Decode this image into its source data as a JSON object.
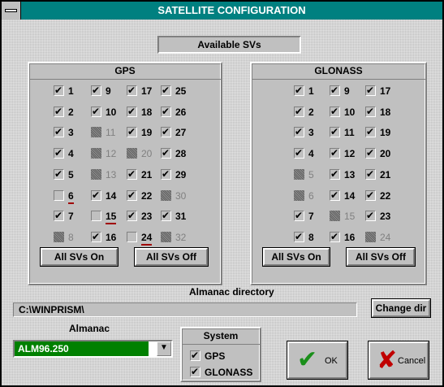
{
  "window": {
    "title": "SATELLITE CONFIGURATION",
    "menu_icon": "system-menu-icon"
  },
  "available_label": "Available SVs",
  "gps": {
    "title": "GPS",
    "svs": [
      {
        "n": "1",
        "state": "on"
      },
      {
        "n": "9",
        "state": "on"
      },
      {
        "n": "17",
        "state": "on"
      },
      {
        "n": "25",
        "state": "on"
      },
      {
        "n": "2",
        "state": "on"
      },
      {
        "n": "10",
        "state": "on"
      },
      {
        "n": "18",
        "state": "on"
      },
      {
        "n": "26",
        "state": "on"
      },
      {
        "n": "3",
        "state": "on"
      },
      {
        "n": "11",
        "state": "grey"
      },
      {
        "n": "19",
        "state": "on"
      },
      {
        "n": "27",
        "state": "on"
      },
      {
        "n": "4",
        "state": "on"
      },
      {
        "n": "12",
        "state": "grey"
      },
      {
        "n": "20",
        "state": "grey"
      },
      {
        "n": "28",
        "state": "on"
      },
      {
        "n": "5",
        "state": "on"
      },
      {
        "n": "13",
        "state": "grey"
      },
      {
        "n": "21",
        "state": "on"
      },
      {
        "n": "29",
        "state": "on"
      },
      {
        "n": "6",
        "state": "off"
      },
      {
        "n": "14",
        "state": "on"
      },
      {
        "n": "22",
        "state": "on"
      },
      {
        "n": "30",
        "state": "grey"
      },
      {
        "n": "7",
        "state": "on"
      },
      {
        "n": "15",
        "state": "off"
      },
      {
        "n": "23",
        "state": "on"
      },
      {
        "n": "31",
        "state": "on"
      },
      {
        "n": "8",
        "state": "grey"
      },
      {
        "n": "16",
        "state": "on"
      },
      {
        "n": "24",
        "state": "off"
      },
      {
        "n": "32",
        "state": "grey"
      }
    ],
    "all_on": "All SVs On",
    "all_off": "All SVs Off"
  },
  "glonass": {
    "title": "GLONASS",
    "svs": [
      {
        "n": "1",
        "state": "on"
      },
      {
        "n": "9",
        "state": "on"
      },
      {
        "n": "17",
        "state": "on"
      },
      {
        "n": "2",
        "state": "on"
      },
      {
        "n": "10",
        "state": "on"
      },
      {
        "n": "18",
        "state": "on"
      },
      {
        "n": "3",
        "state": "on"
      },
      {
        "n": "11",
        "state": "on"
      },
      {
        "n": "19",
        "state": "on"
      },
      {
        "n": "4",
        "state": "on"
      },
      {
        "n": "12",
        "state": "on"
      },
      {
        "n": "20",
        "state": "on"
      },
      {
        "n": "5",
        "state": "grey"
      },
      {
        "n": "13",
        "state": "on"
      },
      {
        "n": "21",
        "state": "on"
      },
      {
        "n": "6",
        "state": "grey"
      },
      {
        "n": "14",
        "state": "on"
      },
      {
        "n": "22",
        "state": "on"
      },
      {
        "n": "7",
        "state": "on"
      },
      {
        "n": "15",
        "state": "grey"
      },
      {
        "n": "23",
        "state": "on"
      },
      {
        "n": "8",
        "state": "on"
      },
      {
        "n": "16",
        "state": "on"
      },
      {
        "n": "24",
        "state": "grey"
      }
    ],
    "all_on": "All SVs On",
    "all_off": "All SVs Off"
  },
  "almanac_dir": {
    "label": "Almanac directory",
    "path": "C:\\WINPRISM\\",
    "change_button": "Change dir"
  },
  "almanac": {
    "label": "Almanac",
    "selected": "ALM96.250",
    "dropdown_icon": "dropdown-arrow-icon"
  },
  "system": {
    "label": "System",
    "items": [
      "GPS",
      "GLONASS"
    ]
  },
  "ok_button": {
    "label": "OK",
    "icon": "green-checkmark-icon"
  },
  "cancel_button": {
    "label": "Cancel",
    "icon": "red-x-icon"
  }
}
